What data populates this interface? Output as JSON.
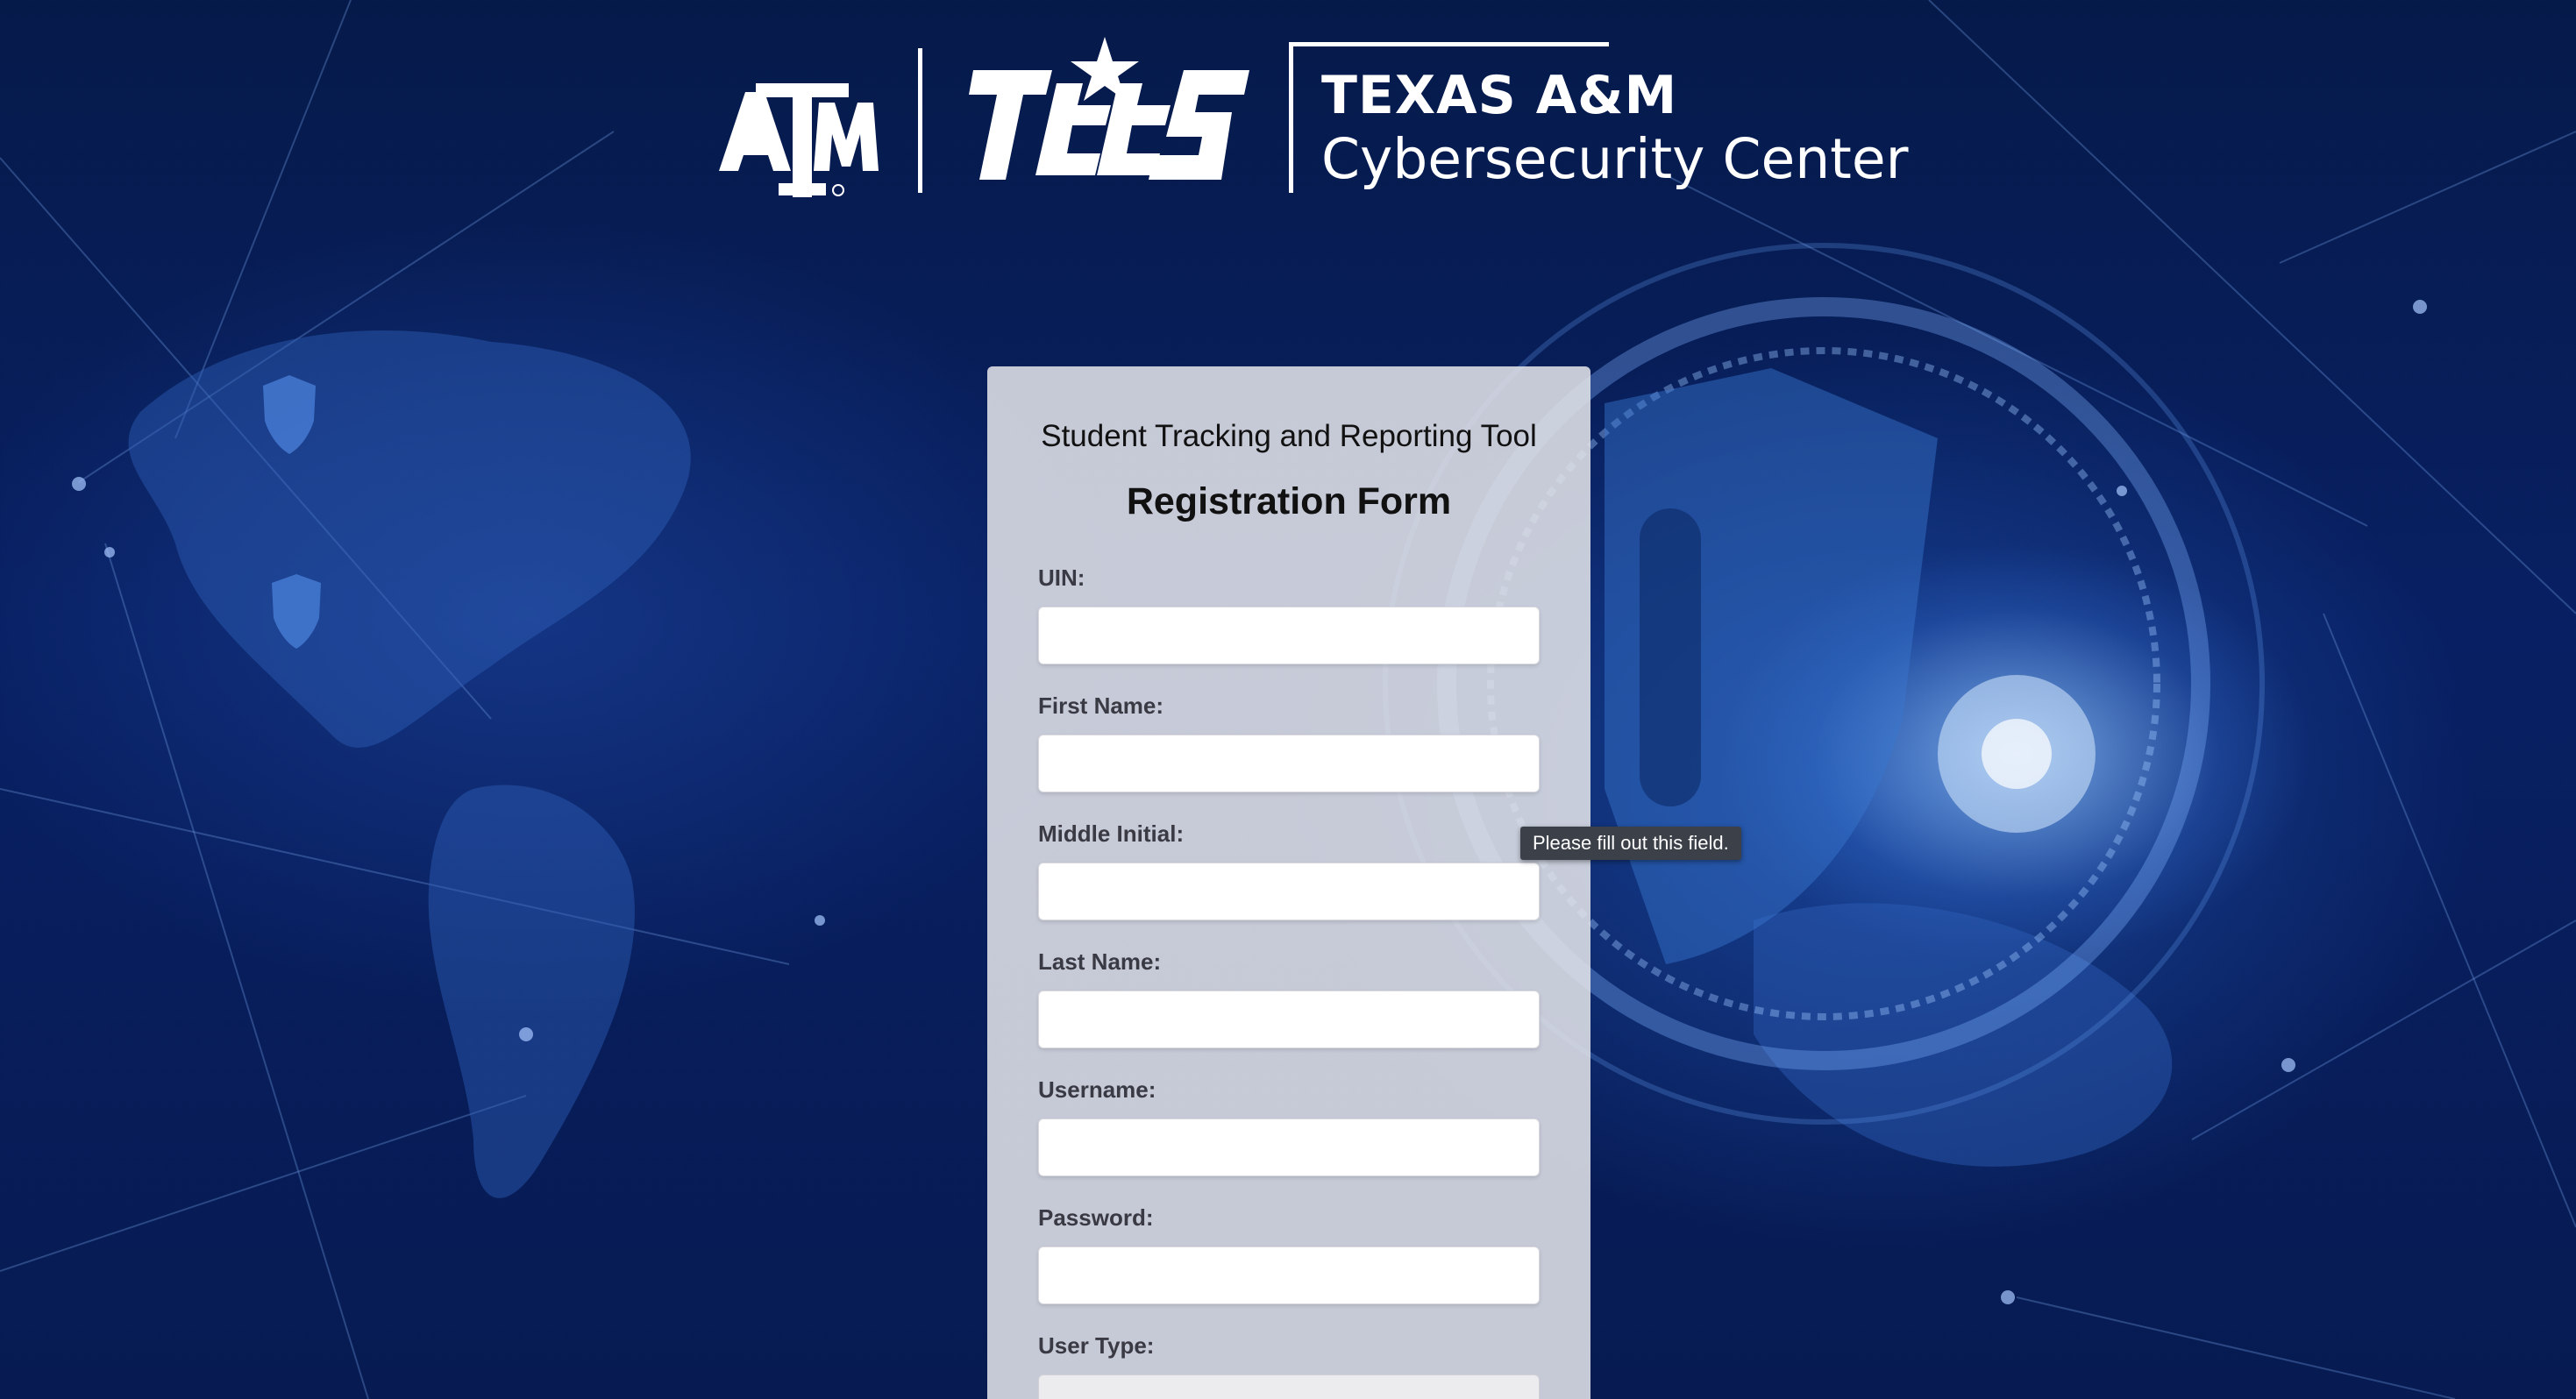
{
  "header": {
    "tamu_logo_text": "ATM",
    "tees_logo_text": "TEES",
    "cyber_line1": "TEXAS A&M",
    "cyber_line2": "Cybersecurity Center"
  },
  "form": {
    "app_title": "Student Tracking and Reporting Tool",
    "title": "Registration Form",
    "fields": [
      {
        "label": "UIN:",
        "value": ""
      },
      {
        "label": "First Name:",
        "value": ""
      },
      {
        "label": "Middle Initial:",
        "value": ""
      },
      {
        "label": "Last Name:",
        "value": ""
      },
      {
        "label": "Username:",
        "value": ""
      },
      {
        "label": "Password:",
        "value": ""
      },
      {
        "label": "User Type:",
        "value": ""
      }
    ]
  },
  "tooltip": {
    "text": "Please fill out this field."
  },
  "colors": {
    "background": "#082063",
    "card": "#e1e2e8",
    "tooltip": "#3c4048",
    "logo": "#ffffff"
  }
}
